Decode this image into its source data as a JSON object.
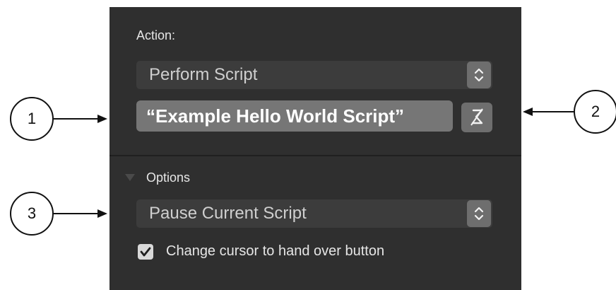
{
  "panel": {
    "action_label": "Action:",
    "action_popup": {
      "value": "Perform Script",
      "stepper_icon": "up-down-chevron-icon"
    },
    "script_parameter": {
      "value": "“Example Hello World Script”",
      "specify_icon": "calculation-specify-icon"
    },
    "options": {
      "heading": "Options",
      "disclosure_icon": "disclosure-triangle-icon",
      "popup": {
        "value": "Pause Current Script",
        "stepper_icon": "up-down-chevron-icon"
      },
      "checkbox": {
        "label": "Change cursor to hand over button",
        "checked": true
      }
    }
  },
  "callouts": [
    {
      "label": "1"
    },
    {
      "label": "2"
    },
    {
      "label": "3"
    }
  ],
  "colors": {
    "panel_background": "#2f2f2f",
    "field_highlight": "#767676",
    "text_light": "#e6e6e6",
    "callout_stroke": "#111111"
  }
}
